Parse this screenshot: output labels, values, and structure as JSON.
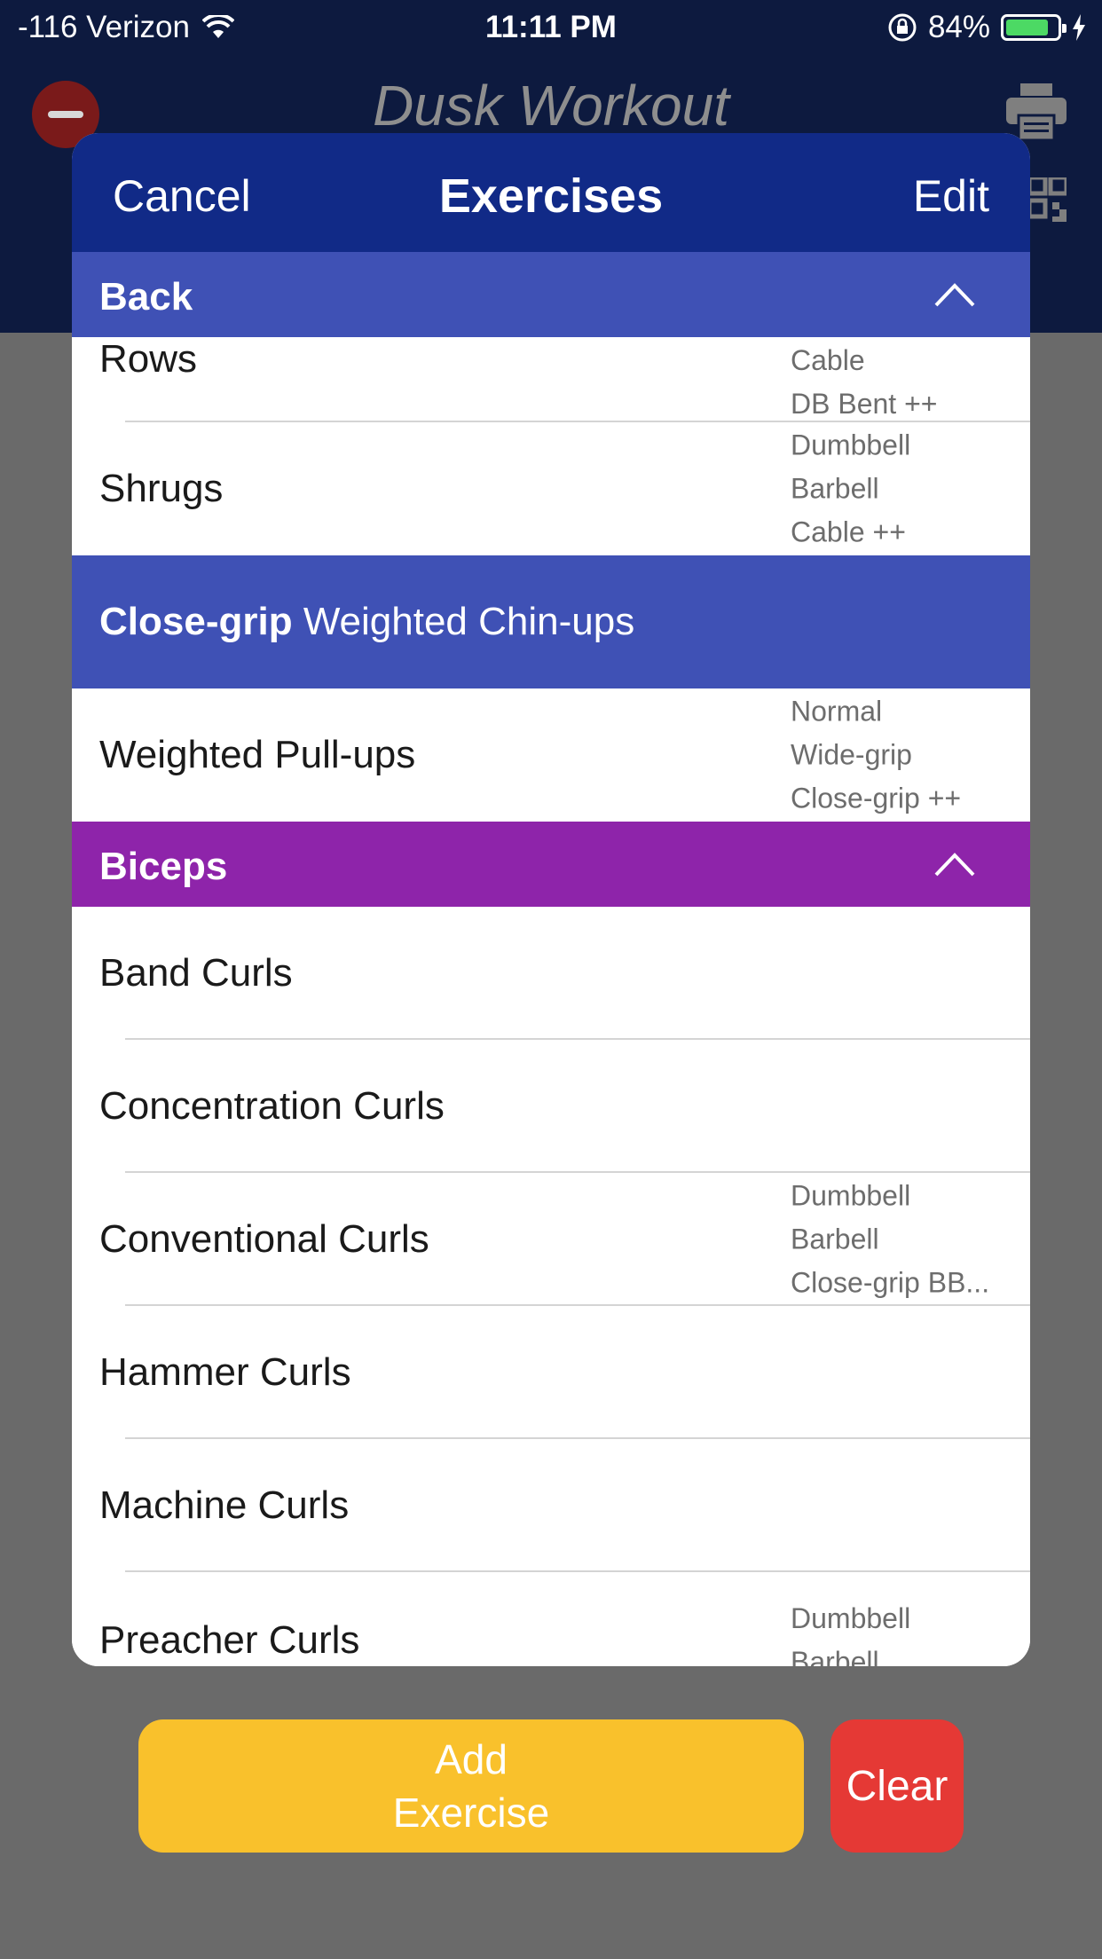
{
  "status_bar": {
    "carrier": "-116 Verizon",
    "time": "11:11 PM",
    "battery_percent": "84%",
    "battery_level": 0.84
  },
  "app": {
    "title": "Dusk Workout"
  },
  "modal": {
    "cancel_label": "Cancel",
    "title": "Exercises",
    "edit_label": "Edit"
  },
  "sections": [
    {
      "label": "Back",
      "color": "#3f51b5",
      "rows": [
        {
          "name": "Rows",
          "subs": [
            "Cable",
            "DB Bent ++"
          ]
        },
        {
          "name": "Shrugs",
          "subs": [
            "Dumbbell",
            "Barbell",
            "Cable ++"
          ]
        },
        {
          "name_prefix": "Close-grip",
          "name": "Weighted Chin-ups",
          "selected": true
        },
        {
          "name": "Weighted Pull-ups",
          "subs": [
            "Normal",
            "Wide-grip",
            "Close-grip ++"
          ]
        }
      ]
    },
    {
      "label": "Biceps",
      "color": "#8e24aa",
      "rows": [
        {
          "name": "Band Curls"
        },
        {
          "name": "Concentration Curls"
        },
        {
          "name": "Conventional Curls",
          "subs": [
            "Dumbbell",
            "Barbell",
            "Close-grip BB..."
          ]
        },
        {
          "name": "Hammer Curls"
        },
        {
          "name": "Machine Curls"
        },
        {
          "name": "Preacher Curls",
          "subs": [
            "Dumbbell",
            "Barbell"
          ]
        }
      ]
    }
  ],
  "buttons": {
    "add_exercise": "Add Exercise",
    "clear": "Clear"
  },
  "colors": {
    "header_bg": "#0d1a3f",
    "modal_header_bg": "#112a87",
    "add_button": "#f9c12c",
    "clear_button": "#e53935"
  },
  "icons": [
    "wifi-icon",
    "lock-rotation-icon",
    "battery-icon",
    "charging-icon",
    "delete-icon",
    "printer-icon",
    "qr-code-icon",
    "chevron-up-icon"
  ]
}
